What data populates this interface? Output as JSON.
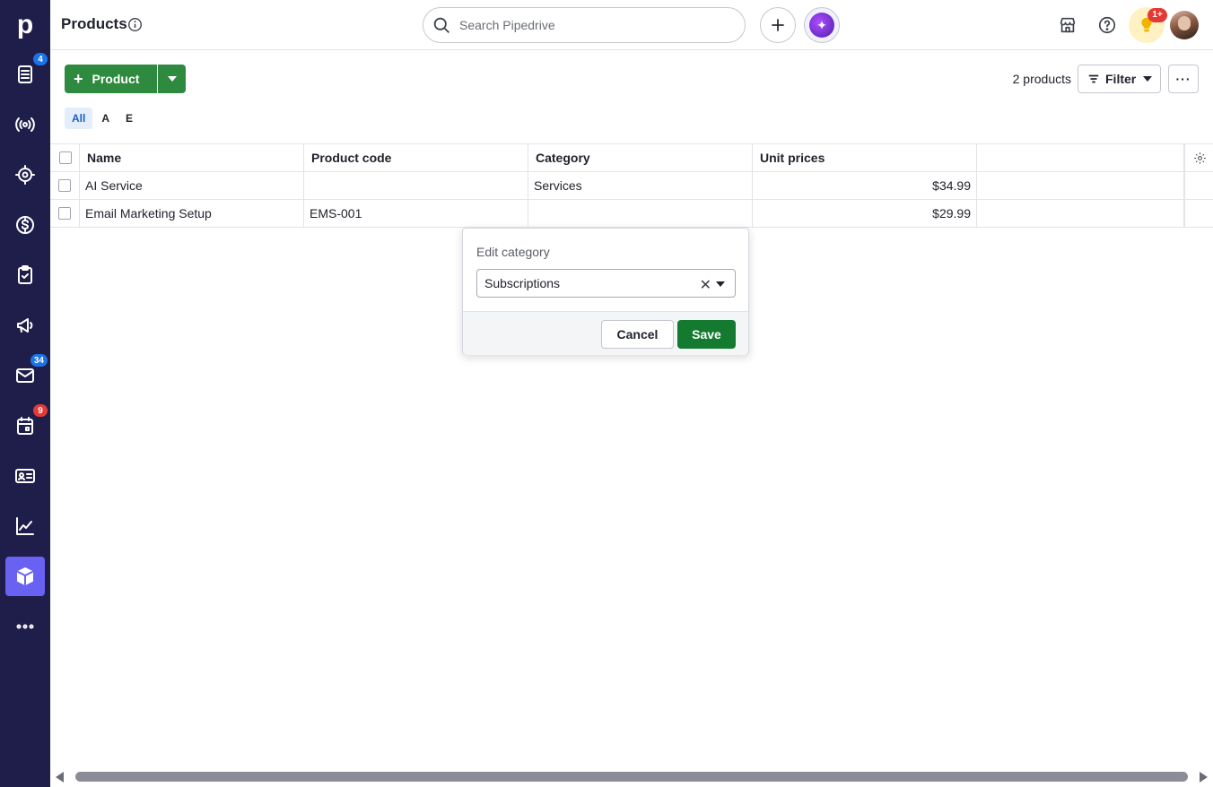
{
  "app": {
    "logo_letter": "p"
  },
  "sidebar": {
    "items": [
      {
        "name": "leads",
        "icon": "leads-icon",
        "badge": "4"
      },
      {
        "name": "radar",
        "icon": "broadcast-icon",
        "badge": ""
      },
      {
        "name": "deals-target",
        "icon": "target-icon",
        "badge": ""
      },
      {
        "name": "deals",
        "icon": "dollar-icon",
        "badge": ""
      },
      {
        "name": "activities",
        "icon": "clipboard-check-icon",
        "badge": ""
      },
      {
        "name": "campaigns",
        "icon": "megaphone-icon",
        "badge": ""
      },
      {
        "name": "mail",
        "icon": "mail-icon",
        "badge": "34"
      },
      {
        "name": "calendar",
        "icon": "calendar-icon",
        "badge": "9"
      },
      {
        "name": "contacts",
        "icon": "contact-card-icon",
        "badge": ""
      },
      {
        "name": "insights",
        "icon": "chart-icon",
        "badge": ""
      },
      {
        "name": "products",
        "icon": "box-icon",
        "badge": "",
        "active": true
      },
      {
        "name": "more",
        "icon": "more-icon",
        "badge": ""
      }
    ]
  },
  "header": {
    "title": "Products",
    "search_placeholder": "Search Pipedrive",
    "bulb_badge": "1+"
  },
  "toolbar": {
    "add_label": "Product",
    "count_label": "2 products",
    "filter_label": "Filter",
    "more_label": "···"
  },
  "letter_tabs": [
    "All",
    "A",
    "E"
  ],
  "table": {
    "columns": [
      "Name",
      "Product code",
      "Category",
      "Unit prices"
    ],
    "rows": [
      {
        "name": "AI Service",
        "code": "",
        "category": "Services",
        "price": "$34.99"
      },
      {
        "name": "Email Marketing Setup",
        "code": "EMS-001",
        "category": "",
        "price": "$29.99"
      }
    ]
  },
  "popover": {
    "title": "Edit category",
    "selected": "Subscriptions",
    "clear_glyph": "✕",
    "cancel_label": "Cancel",
    "save_label": "Save"
  },
  "colors": {
    "sidebar_bg": "#1f1e4a",
    "active_nav": "#6861f2",
    "primary_green": "#2d8a3e",
    "save_green": "#137a2f"
  }
}
